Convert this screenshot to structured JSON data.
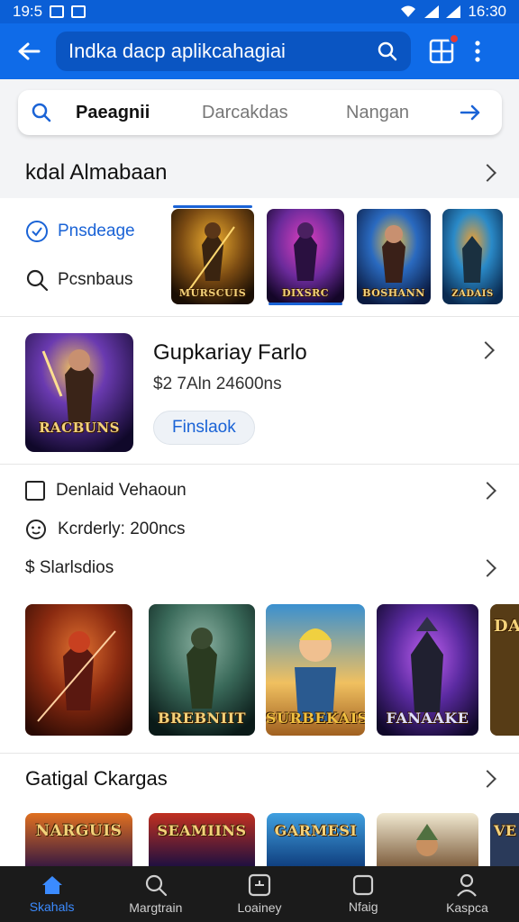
{
  "status_bar": {
    "time_left": "19:5",
    "time_right": "16:30"
  },
  "app_bar": {
    "search_text": "Indka dacp aplikcahagiai"
  },
  "tabs": [
    {
      "label": "Paeagnii",
      "active": true
    },
    {
      "label": "Darcakdas",
      "active": false
    },
    {
      "label": "Nangan",
      "active": false
    }
  ],
  "section1": {
    "title": "kdal Almabaan"
  },
  "filters": [
    {
      "label": "Pnsdeage",
      "selected": true
    },
    {
      "label": "Pcsnbaus",
      "selected": false
    }
  ],
  "featured": [
    {
      "label": "MURSCUIS",
      "colors": [
        "#7a4a12",
        "#2a1a08"
      ],
      "accent": "#f0b030"
    },
    {
      "label": "DIXSRC",
      "colors": [
        "#6a2a9a",
        "#1a0a3a"
      ],
      "accent": "#e040c0"
    },
    {
      "label": "BOSHANN",
      "colors": [
        "#2a6ac0",
        "#0a1a40"
      ],
      "accent": "#f0c040"
    },
    {
      "label": "ZADAIS",
      "colors": [
        "#2a8ac8",
        "#0a2a50"
      ],
      "accent": "#f0a030"
    }
  ],
  "detail": {
    "title": "Gupkariay Farlo",
    "subtitle": "$2 7Aln 24600ns",
    "button": "Finslaok",
    "image_label": "RACBUNS"
  },
  "info_rows": [
    {
      "label": "Denlaid Vehaoun",
      "icon": "checkbox-icon",
      "has_chevron": true
    },
    {
      "label": "Kcrderly: 200ncs",
      "icon": "smiley-icon",
      "has_chevron": false
    },
    {
      "label": "$ Slarlsdios",
      "icon": "none",
      "has_chevron": true
    }
  ],
  "games_row1": [
    {
      "label": "",
      "colors": [
        "#8a2a10",
        "#2a0a04"
      ]
    },
    {
      "label": "BREBNIIT",
      "colors": [
        "#3a6a5a",
        "#0a1a18"
      ]
    },
    {
      "label": "SURBEKAIS",
      "colors": [
        "#f0c060",
        "#3a90d0"
      ]
    },
    {
      "label": "FANAAKE",
      "colors": [
        "#5a2aa0",
        "#10082a"
      ]
    },
    {
      "label": "DAI",
      "colors": [
        "#6a4a1a",
        "#1a1008"
      ]
    }
  ],
  "section2": {
    "title": "Gatigal Ckargas"
  },
  "games_row2": [
    {
      "label": "NARGUIS",
      "colors": [
        "#e07020",
        "#3a1a40"
      ]
    },
    {
      "label": "SEAMIINS",
      "colors": [
        "#c03020",
        "#201040"
      ]
    },
    {
      "label": "GARMESI",
      "colors": [
        "#40a0e0",
        "#104080"
      ]
    },
    {
      "label": "",
      "colors": [
        "#d8c8a0",
        "#806040"
      ]
    },
    {
      "label": "VE",
      "colors": [
        "#2a3a5a",
        "#0a1020"
      ]
    }
  ],
  "bottom_nav": [
    {
      "label": "Skahals",
      "icon": "home-icon",
      "active": true
    },
    {
      "label": "Margtrain",
      "icon": "search-icon",
      "active": false
    },
    {
      "label": "Loainey",
      "icon": "news-icon",
      "active": false
    },
    {
      "label": "Nfaig",
      "icon": "square-icon",
      "active": false
    },
    {
      "label": "Kaspca",
      "icon": "profile-icon",
      "active": false
    }
  ],
  "colors": {
    "brand": "#0f6be8",
    "accent": "#1a63d6",
    "nav_bg": "#1b1b1b"
  }
}
